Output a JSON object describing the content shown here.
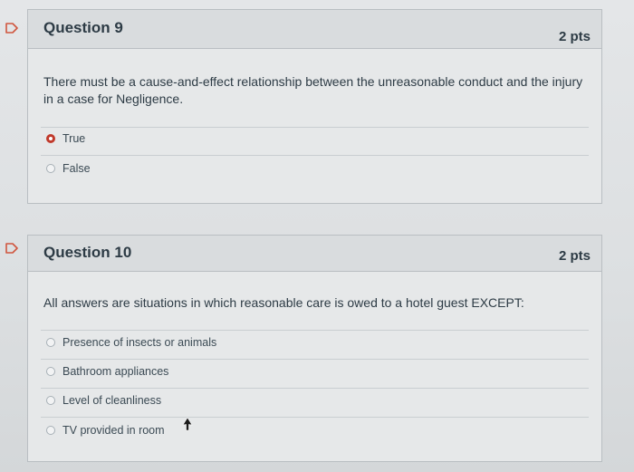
{
  "questions": [
    {
      "title": "Question 9",
      "points": "2 pts",
      "text": "There must be a cause-and-effect relationship between the unreasonable conduct and the injury in a case for Negligence.",
      "answers": [
        {
          "label": "True",
          "selected": true
        },
        {
          "label": "False",
          "selected": false
        }
      ]
    },
    {
      "title": "Question 10",
      "points": "2 pts",
      "text": "All answers are situations in which reasonable care is owed to a hotel guest EXCEPT:",
      "answers": [
        {
          "label": "Presence of insects or animals",
          "selected": false
        },
        {
          "label": "Bathroom appliances",
          "selected": false
        },
        {
          "label": "Level of cleanliness",
          "selected": false
        },
        {
          "label": "TV provided in room",
          "selected": false
        }
      ]
    }
  ],
  "colors": {
    "selected_radio": "#c0392b",
    "flag": "#d0563f"
  },
  "icons": {
    "flag": "flag-icon",
    "cursor": "mouse-pointer-icon"
  }
}
